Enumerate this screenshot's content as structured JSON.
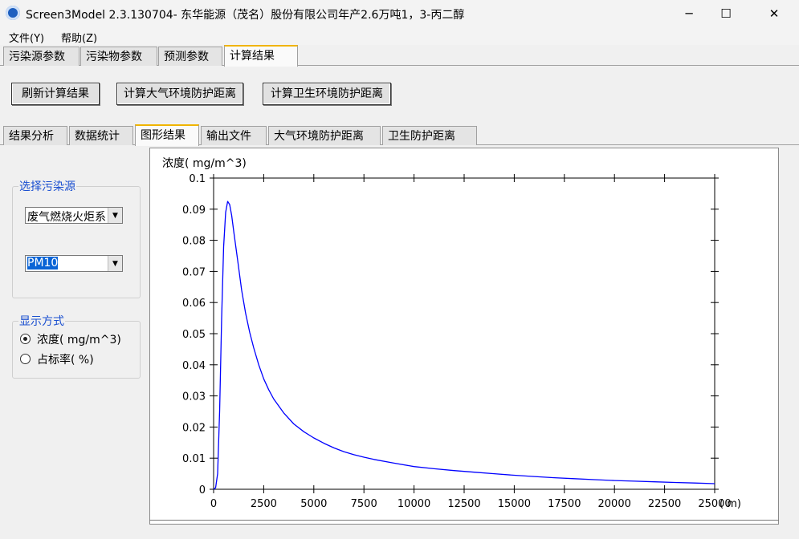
{
  "window": {
    "title": "Screen3Model 2.3.130704- 东华能源（茂名）股份有限公司年产2.6万吨1，3-丙二醇",
    "minimize": "─",
    "maximize": "☐",
    "close": "✕"
  },
  "menu": [
    {
      "label": "文件(Y)"
    },
    {
      "label": "帮助(Z)"
    }
  ],
  "main_tabs": [
    {
      "label": "污染源参数"
    },
    {
      "label": "污染物参数"
    },
    {
      "label": "预测参数"
    },
    {
      "label": "计算结果",
      "active": true
    }
  ],
  "toolbar": {
    "refresh": "刷新计算结果",
    "calc_atmos": "计算大气环境防护距离",
    "calc_health": "计算卫生环境防护距离"
  },
  "sub_tabs": [
    {
      "label": "结果分析"
    },
    {
      "label": "数据统计"
    },
    {
      "label": "图形结果",
      "active": true
    },
    {
      "label": "输出文件"
    },
    {
      "label": "大气环境防护距离"
    },
    {
      "label": "卫生防护距离"
    }
  ],
  "source_group": {
    "legend": "选择污染源",
    "source_value": "废气燃烧火炬系",
    "pollutant_value": "PM10"
  },
  "display_group": {
    "legend": "显示方式",
    "option_conc": "浓度( mg/m^3)",
    "option_ratio": "占标率( %)",
    "selected": "conc"
  },
  "colors": {
    "line": "#0000ff",
    "accent_tab": "#f0b400",
    "legend_text": "#1a4fd0"
  },
  "chart_data": {
    "type": "line",
    "ylabel": "浓度( mg/m^3)",
    "xlabel": "( m)",
    "xlim": [
      0,
      25000
    ],
    "ylim": [
      0,
      0.1
    ],
    "xticks": [
      "0",
      "2500",
      "5000",
      "7500",
      "10000",
      "12500",
      "15000",
      "17500",
      "20000",
      "22500",
      "25000"
    ],
    "yticks": [
      "0",
      "0.01",
      "0.02",
      "0.03",
      "0.04",
      "0.05",
      "0.06",
      "0.07",
      "0.08",
      "0.09",
      "0.1"
    ],
    "series": [
      {
        "x": [
          0,
          100,
          200,
          300,
          400,
          500,
          600,
          700,
          800,
          900,
          1000,
          1200,
          1400,
          1600,
          1800,
          2000,
          2250,
          2500,
          2750,
          3000,
          3500,
          4000,
          4500,
          5000,
          5500,
          6000,
          6500,
          7000,
          7500,
          8000,
          9000,
          10000,
          11000,
          12000,
          13000,
          14000,
          15000,
          16000,
          17000,
          18000,
          19000,
          20000,
          21000,
          22000,
          23000,
          24000,
          25000
        ],
        "y": [
          0,
          0.0005,
          0.005,
          0.025,
          0.055,
          0.078,
          0.089,
          0.0925,
          0.0915,
          0.088,
          0.083,
          0.0735,
          0.064,
          0.0565,
          0.0505,
          0.0455,
          0.04,
          0.0355,
          0.032,
          0.029,
          0.0245,
          0.021,
          0.0185,
          0.0165,
          0.0148,
          0.0133,
          0.0121,
          0.0111,
          0.0103,
          0.0096,
          0.0084,
          0.0073,
          0.0066,
          0.006,
          0.0055,
          0.005,
          0.0045,
          0.0041,
          0.0037,
          0.0034,
          0.0031,
          0.0028,
          0.0026,
          0.0024,
          0.0022,
          0.002,
          0.0018
        ]
      }
    ]
  }
}
